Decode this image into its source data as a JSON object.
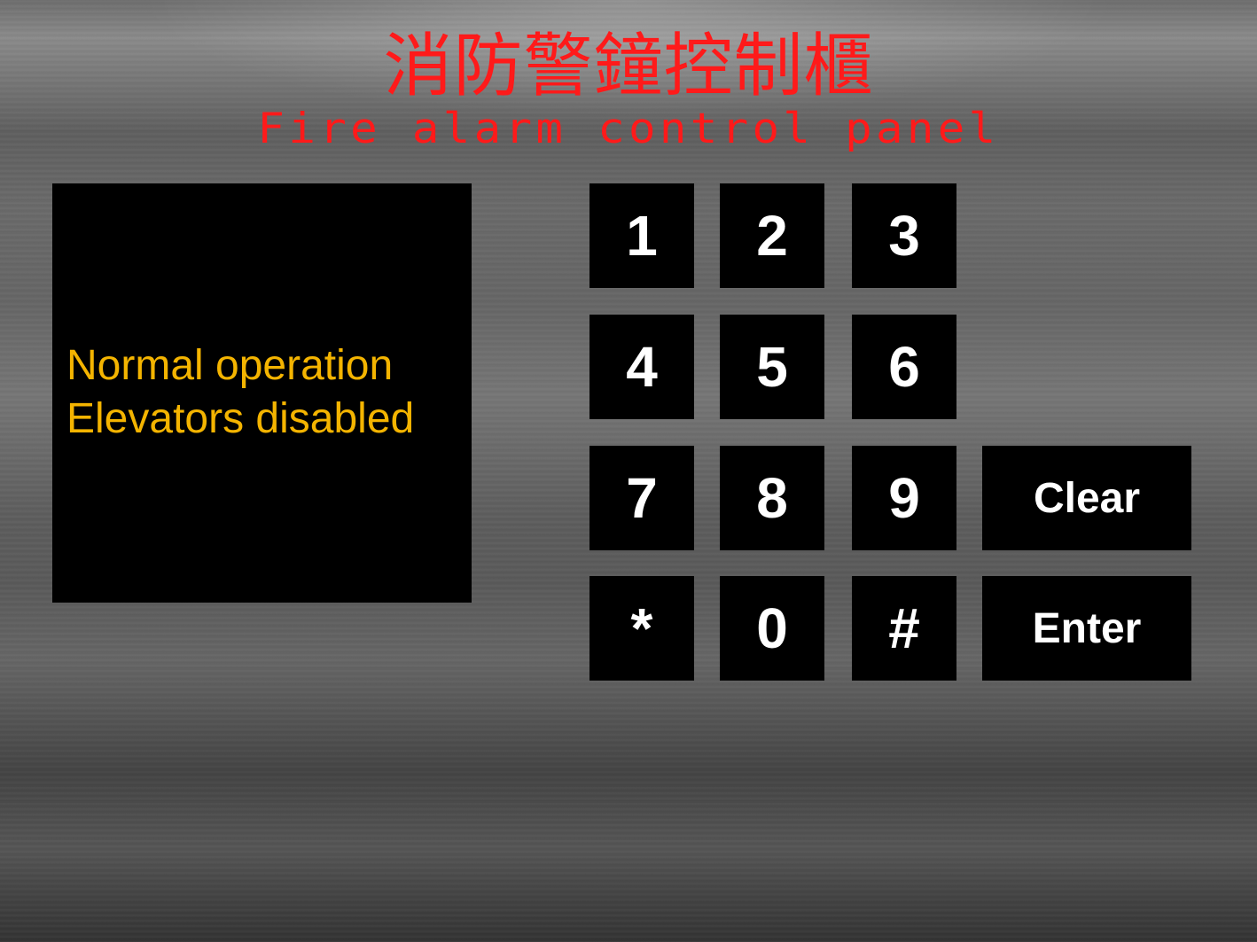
{
  "header": {
    "title_cn": "消防警鐘控制櫃",
    "title_en": "Fire alarm control panel"
  },
  "display": {
    "line1": "Normal operation",
    "line2": "Elevators disabled"
  },
  "keypad": {
    "k1": "1",
    "k2": "2",
    "k3": "3",
    "k4": "4",
    "k5": "5",
    "k6": "6",
    "k7": "7",
    "k8": "8",
    "k9": "9",
    "kstar": "*",
    "k0": "0",
    "khash": "#",
    "clear": "Clear",
    "enter": "Enter"
  },
  "colors": {
    "title": "#ff1a1a",
    "status_text": "#f4b400",
    "key_background": "#000000",
    "key_text": "#ffffff"
  }
}
